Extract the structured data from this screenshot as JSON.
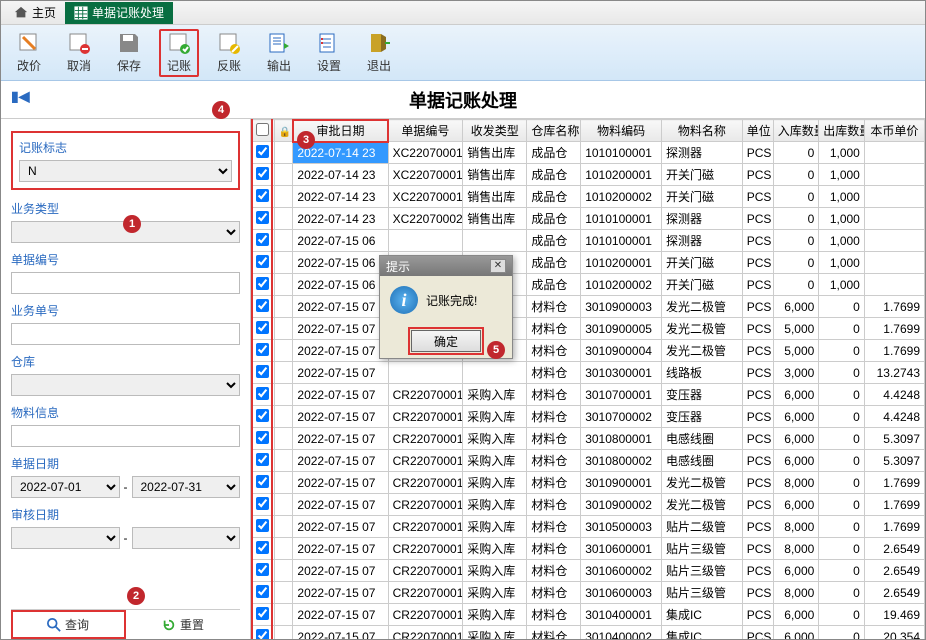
{
  "tabs": {
    "home": "主页",
    "current": "单据记账处理"
  },
  "toolbar": {
    "price": "改价",
    "cancel": "取消",
    "save": "保存",
    "post": "记账",
    "unpost": "反账",
    "export": "输出",
    "settings": "设置",
    "exit": "退出"
  },
  "page_title": "单据记账处理",
  "sidebar": {
    "flag_label": "记账标志",
    "flag_value": "N",
    "biztype_label": "业务类型",
    "biztype_value": "",
    "docno_label": "单据编号",
    "docno_value": "",
    "bizno_label": "业务单号",
    "bizno_value": "",
    "wh_label": "仓库",
    "wh_value": "",
    "mat_label": "物料信息",
    "mat_value": "",
    "docdate_label": "单据日期",
    "docdate_from": "2022-07-01",
    "docdate_to": "2022-07-31",
    "auditdate_label": "审核日期",
    "auditdate_from": "",
    "auditdate_to": "",
    "date_sep": "-",
    "query": "查询",
    "reset": "重置"
  },
  "headers": {
    "check": "",
    "lock": "",
    "audit_date": "审批日期",
    "doc_no": "单据编号",
    "trx_type": "收发类型",
    "wh_name": "仓库名称",
    "mat_code": "物料编码",
    "mat_name": "物料名称",
    "unit": "单位",
    "in_qty": "入库数量",
    "out_qty": "出库数量",
    "price": "本币单价"
  },
  "rows": [
    {
      "sel": true,
      "date": "2022-07-14 23",
      "doc": "XC22070001",
      "type": "销售出库",
      "wh": "成品仓",
      "mat": "1010100001",
      "name": "探测器",
      "unit": "PCS",
      "in": "0",
      "out": "1,000",
      "price": ""
    },
    {
      "date": "2022-07-14 23",
      "doc": "XC22070001",
      "type": "销售出库",
      "wh": "成品仓",
      "mat": "1010200001",
      "name": "开关门磁",
      "unit": "PCS",
      "in": "0",
      "out": "1,000",
      "price": ""
    },
    {
      "date": "2022-07-14 23",
      "doc": "XC22070001",
      "type": "销售出库",
      "wh": "成品仓",
      "mat": "1010200002",
      "name": "开关门磁",
      "unit": "PCS",
      "in": "0",
      "out": "1,000",
      "price": ""
    },
    {
      "date": "2022-07-14 23",
      "doc": "XC22070002",
      "type": "销售出库",
      "wh": "成品仓",
      "mat": "1010100001",
      "name": "探测器",
      "unit": "PCS",
      "in": "0",
      "out": "1,000",
      "price": ""
    },
    {
      "date": "2022-07-15 06",
      "doc": "",
      "type": "",
      "wh": "成品仓",
      "mat": "1010100001",
      "name": "探测器",
      "unit": "PCS",
      "in": "0",
      "out": "1,000",
      "price": ""
    },
    {
      "date": "2022-07-15 06",
      "doc": "",
      "type": "",
      "wh": "成品仓",
      "mat": "1010200001",
      "name": "开关门磁",
      "unit": "PCS",
      "in": "0",
      "out": "1,000",
      "price": ""
    },
    {
      "date": "2022-07-15 06",
      "doc": "",
      "type": "",
      "wh": "成品仓",
      "mat": "1010200002",
      "name": "开关门磁",
      "unit": "PCS",
      "in": "0",
      "out": "1,000",
      "price": ""
    },
    {
      "date": "2022-07-15 07",
      "doc": "",
      "type": "",
      "wh": "材料仓",
      "mat": "3010900003",
      "name": "发光二极管",
      "unit": "PCS",
      "in": "6,000",
      "out": "0",
      "price": "1.7699"
    },
    {
      "date": "2022-07-15 07",
      "doc": "",
      "type": "",
      "wh": "材料仓",
      "mat": "3010900005",
      "name": "发光二极管",
      "unit": "PCS",
      "in": "5,000",
      "out": "0",
      "price": "1.7699"
    },
    {
      "date": "2022-07-15 07",
      "doc": "",
      "type": "",
      "wh": "材料仓",
      "mat": "3010900004",
      "name": "发光二极管",
      "unit": "PCS",
      "in": "5,000",
      "out": "0",
      "price": "1.7699"
    },
    {
      "date": "2022-07-15 07",
      "doc": "",
      "type": "",
      "wh": "材料仓",
      "mat": "3010300001",
      "name": "线路板",
      "unit": "PCS",
      "in": "3,000",
      "out": "0",
      "price": "13.2743"
    },
    {
      "date": "2022-07-15 07",
      "doc": "CR22070001",
      "type": "采购入库",
      "wh": "材料仓",
      "mat": "3010700001",
      "name": "变压器",
      "unit": "PCS",
      "in": "6,000",
      "out": "0",
      "price": "4.4248"
    },
    {
      "date": "2022-07-15 07",
      "doc": "CR22070001",
      "type": "采购入库",
      "wh": "材料仓",
      "mat": "3010700002",
      "name": "变压器",
      "unit": "PCS",
      "in": "6,000",
      "out": "0",
      "price": "4.4248"
    },
    {
      "date": "2022-07-15 07",
      "doc": "CR22070001",
      "type": "采购入库",
      "wh": "材料仓",
      "mat": "3010800001",
      "name": "电感线圈",
      "unit": "PCS",
      "in": "6,000",
      "out": "0",
      "price": "5.3097"
    },
    {
      "date": "2022-07-15 07",
      "doc": "CR22070001",
      "type": "采购入库",
      "wh": "材料仓",
      "mat": "3010800002",
      "name": "电感线圈",
      "unit": "PCS",
      "in": "6,000",
      "out": "0",
      "price": "5.3097"
    },
    {
      "date": "2022-07-15 07",
      "doc": "CR22070001",
      "type": "采购入库",
      "wh": "材料仓",
      "mat": "3010900001",
      "name": "发光二极管",
      "unit": "PCS",
      "in": "8,000",
      "out": "0",
      "price": "1.7699"
    },
    {
      "date": "2022-07-15 07",
      "doc": "CR22070001",
      "type": "采购入库",
      "wh": "材料仓",
      "mat": "3010900002",
      "name": "发光二极管",
      "unit": "PCS",
      "in": "6,000",
      "out": "0",
      "price": "1.7699"
    },
    {
      "date": "2022-07-15 07",
      "doc": "CR22070001",
      "type": "采购入库",
      "wh": "材料仓",
      "mat": "3010500003",
      "name": "贴片二级管",
      "unit": "PCS",
      "in": "8,000",
      "out": "0",
      "price": "1.7699"
    },
    {
      "date": "2022-07-15 07",
      "doc": "CR22070001",
      "type": "采购入库",
      "wh": "材料仓",
      "mat": "3010600001",
      "name": "贴片三级管",
      "unit": "PCS",
      "in": "8,000",
      "out": "0",
      "price": "2.6549"
    },
    {
      "date": "2022-07-15 07",
      "doc": "CR22070001",
      "type": "采购入库",
      "wh": "材料仓",
      "mat": "3010600002",
      "name": "贴片三级管",
      "unit": "PCS",
      "in": "6,000",
      "out": "0",
      "price": "2.6549"
    },
    {
      "date": "2022-07-15 07",
      "doc": "CR22070001",
      "type": "采购入库",
      "wh": "材料仓",
      "mat": "3010600003",
      "name": "贴片三级管",
      "unit": "PCS",
      "in": "8,000",
      "out": "0",
      "price": "2.6549"
    },
    {
      "date": "2022-07-15 07",
      "doc": "CR22070001",
      "type": "采购入库",
      "wh": "材料仓",
      "mat": "3010400001",
      "name": "集成IC",
      "unit": "PCS",
      "in": "6,000",
      "out": "0",
      "price": "19.469"
    },
    {
      "date": "2022-07-15 07",
      "doc": "CR22070001",
      "type": "采购入库",
      "wh": "材料仓",
      "mat": "3010400002",
      "name": "集成IC",
      "unit": "PCS",
      "in": "6,000",
      "out": "0",
      "price": "20.354"
    }
  ],
  "dialog": {
    "title": "提示",
    "message": "记账完成!",
    "ok": "确定"
  },
  "badges": {
    "b1": "1",
    "b2": "2",
    "b3": "3",
    "b4": "4",
    "b5": "5"
  }
}
